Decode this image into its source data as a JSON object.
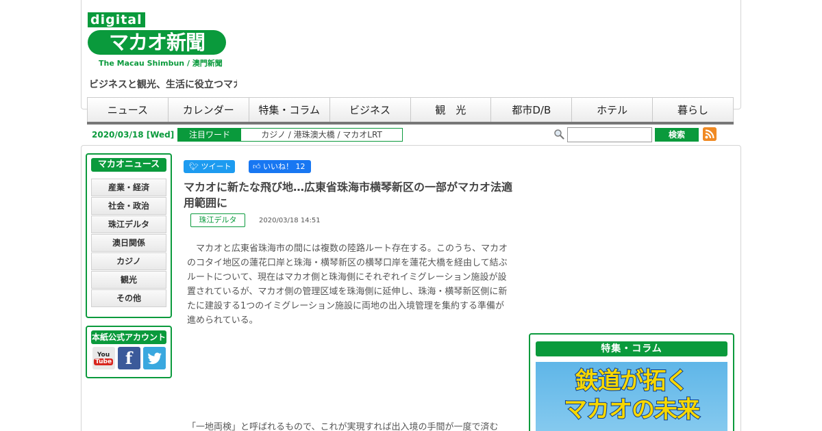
{
  "header": {
    "logo_digital": "digital",
    "logo_main": "マカオ新聞",
    "logo_sub": "The Macau Shimbun / 澳門新聞",
    "tagline": "ビジネスと観光、生活に役立つマカオ"
  },
  "nav": {
    "items": [
      "ニュース",
      "カレンダー",
      "特集・コラム",
      "ビジネス",
      "観　光",
      "都市D/B",
      "ホテル",
      "暮らし"
    ]
  },
  "infobar": {
    "date": "2020/03/18 [Wed]",
    "hotword_label": "注目ワード",
    "hotword_links": "カジノ / 港珠澳大橋 / マカオLRT",
    "search_button": "検索",
    "search_value": ""
  },
  "sidebar": {
    "news_title": "マカオニュース",
    "news_items": [
      "産業・経済",
      "社会・政治",
      "珠江デルタ",
      "澳日関係",
      "カジノ",
      "観光",
      "その他"
    ],
    "accounts_title": "本紙公式アカウント",
    "social": [
      "youtube-icon",
      "facebook-icon",
      "twitter-icon"
    ]
  },
  "article": {
    "tweet_label": "ツイート",
    "like_label": "いいね！ 12",
    "title": "マカオに新たな飛び地…広東省珠海市横琴新区の一部がマカオ法適用範囲に",
    "category": "珠江デルタ",
    "published": "2020/03/18 14:51",
    "body": "　マカオと広東省珠海市の間には複数の陸路ルート存在する。このうち、マカオのコタイ地区の蓮花口岸と珠海・横琴新区の横琴口岸を蓮花大橋を経由して結ぶルートについて、現在はマカオ側と珠海側にそれぞれイミグレーション施設が設置されているが、マカオ側の管理区域を珠海側に延伸し、珠海・横琴新区側に新たに建設する1つのイミグレーション施設に両地の出入境管理を集約する準備が進められている。",
    "body2": "「一地両検」と呼ばれるもので、これが実現すれば出入境の手間が一度で済む"
  },
  "feature": {
    "title": "特集・コラム",
    "banner_line1": "鉄道が拓く",
    "banner_line2": "マカオの未来"
  },
  "colors": {
    "brand_green": "#0a9a3c",
    "rss_orange": "#f08a24"
  }
}
